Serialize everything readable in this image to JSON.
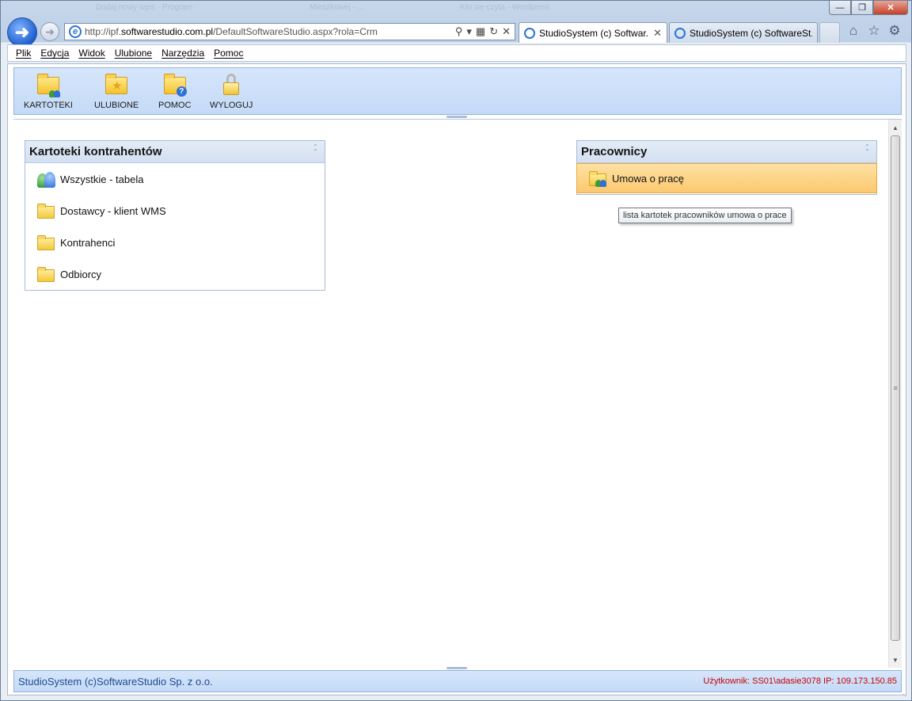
{
  "browser": {
    "ghost_tabs": [
      "Dodaj nowy wpis - Program",
      "Mieszkowej - ...",
      "Kto się czyta - Wordpress"
    ],
    "address": {
      "url_prefix": "http://ipf.",
      "url_domain": "softwarestudio.com.pl",
      "url_path": "/DefaultSoftwareStudio.aspx?rola=Crm"
    },
    "tabs": [
      {
        "label": "StudioSystem (c) Softwar...",
        "active": true
      },
      {
        "label": "StudioSystem (c) SoftwareSt...",
        "active": false
      }
    ],
    "icons": [
      "home-icon",
      "favorites-star-icon",
      "gear-icon"
    ]
  },
  "menubar": {
    "items": [
      "Plik",
      "Edycja",
      "Widok",
      "Ulubione",
      "Narzędzia",
      "Pomoc"
    ]
  },
  "toolbar": {
    "buttons": [
      {
        "label": "KARTOTEKI",
        "icon": "folder-people-icon"
      },
      {
        "label": "ULUBIONE",
        "icon": "folder-star-icon"
      },
      {
        "label": "POMOC",
        "icon": "folder-help-icon"
      },
      {
        "label": "WYLOGUJ",
        "icon": "lock-icon"
      }
    ]
  },
  "panels": {
    "left": {
      "title": "Kartoteki kontrahentów",
      "items": [
        {
          "label": "Wszystkie - tabela",
          "icon": "people-icon"
        },
        {
          "label": "Dostawcy - klient WMS",
          "icon": "folder-icon"
        },
        {
          "label": "Kontrahenci",
          "icon": "folder-icon"
        },
        {
          "label": "Odbiorcy",
          "icon": "folder-icon"
        }
      ]
    },
    "right": {
      "title": "Pracownicy",
      "items": [
        {
          "label": "Umowa o pracę",
          "icon": "folder-people-icon"
        }
      ]
    }
  },
  "tooltip": {
    "text": "lista kartotek pracowników umowa o prace"
  },
  "status": {
    "left": "StudioSystem (c)SoftwareStudio Sp. z o.o.",
    "right": "Użytkownik: SS01\\adasie3078 IP: 109.173.150.85"
  }
}
